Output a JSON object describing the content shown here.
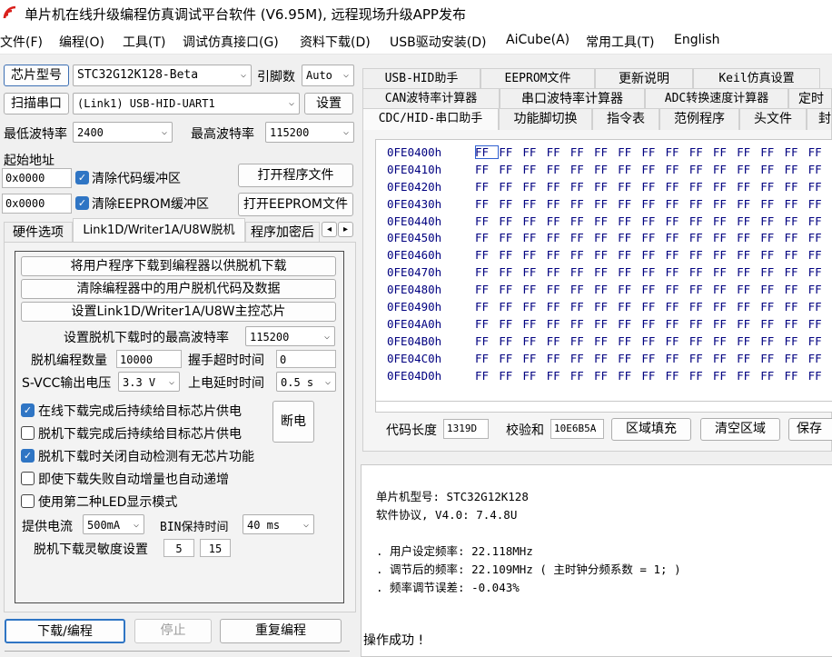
{
  "window": {
    "title": "单片机在线升级编程仿真调试平台软件 (V6.95M), 远程现场升级APP发布"
  },
  "menu": [
    "文件(F)",
    "编程(O)",
    "工具(T)",
    "调试仿真接口(G)",
    "资料下载(D)",
    "USB驱动安装(D)",
    "AiCube(A)",
    "常用工具(T)",
    "English"
  ],
  "left": {
    "chip_type_label": "芯片型号",
    "chip_type_value": "STC32G12K128-Beta",
    "pin_label": "引脚数",
    "pin_value": "Auto",
    "scan_port_label": "扫描串口",
    "port_value": "(Link1) USB-HID-UART1",
    "settings_label": "设置",
    "min_baud_label": "最低波特率",
    "min_baud_value": "2400",
    "max_baud_label": "最高波特率",
    "max_baud_value": "115200",
    "start_addr_label": "起始地址",
    "code_addr": "0x0000",
    "clear_code_label": "清除代码缓冲区",
    "open_program_label": "打开程序文件",
    "eeprom_addr": "0x0000",
    "clear_eeprom_label": "清除EEPROM缓冲区",
    "open_eeprom_label": "打开EEPROM文件",
    "tabs": [
      "硬件选项",
      "Link1D/Writer1A/U8W脱机",
      "程序加密后"
    ],
    "tab_scroll_left": "◂",
    "tab_scroll_right": "▸",
    "panel": {
      "btn_download_to_programmer": "将用户程序下载到编程器以供脱机下载",
      "btn_clear_programmer": "清除编程器中的用户脱机代码及数据",
      "btn_set_master": "设置Link1D/Writer1A/U8W主控芯片",
      "max_baud_offline_label": "设置脱机下载时的最高波特率",
      "max_baud_offline_value": "115200",
      "offline_count_label": "脱机编程数量",
      "offline_count_value": "10000",
      "handshake_label": "握手超时时间",
      "handshake_value": "0",
      "svcc_label": "S-VCC输出电压",
      "svcc_value": "3.3 V",
      "power_delay_label": "上电延时时间",
      "power_delay_value": "0.5 s",
      "options": [
        {
          "label": "在线下载完成后持续给目标芯片供电",
          "checked": true
        },
        {
          "label": "脱机下载完成后持续给目标芯片供电",
          "checked": false
        },
        {
          "label": "脱机下载时关闭自动检测有无芯片功能",
          "checked": true
        },
        {
          "label": "即使下载失败自动增量也自动递增",
          "checked": false
        },
        {
          "label": "使用第二种LED显示模式",
          "checked": false
        }
      ],
      "power_off_label": "断电",
      "supply_current_label": "提供电流",
      "supply_current_value": "500mA",
      "bin_hold_label": "BIN保持时间",
      "bin_hold_value": "40 ms",
      "sensitivity_label": "脱机下载灵敏度设置",
      "sensitivity_a": "5",
      "sensitivity_b": "15"
    },
    "download_label": "下载/编程",
    "stop_label": "停止",
    "reprogram_label": "重复编程"
  },
  "right": {
    "tabs_row1": [
      "USB-HID助手",
      "EEPROM文件",
      "更新说明",
      "Keil仿真设置"
    ],
    "tabs_row2": [
      "CAN波特率计算器",
      "串口波特率计算器",
      "ADC转换速度计算器",
      "定时"
    ],
    "tabs_row3": [
      "CDC/HID-串口助手",
      "功能脚切换",
      "指令表",
      "范例程序",
      "头文件",
      "封"
    ],
    "hex_rows": [
      {
        "addr": "0FE0400h",
        "bytes": [
          "FF",
          "FF",
          "FF",
          "FF",
          "FF",
          "FF",
          "FF",
          "FF",
          "FF",
          "FF",
          "FF",
          "FF",
          "FF",
          "FF",
          "FF"
        ]
      },
      {
        "addr": "0FE0410h",
        "bytes": [
          "FF",
          "FF",
          "FF",
          "FF",
          "FF",
          "FF",
          "FF",
          "FF",
          "FF",
          "FF",
          "FF",
          "FF",
          "FF",
          "FF",
          "FF"
        ]
      },
      {
        "addr": "0FE0420h",
        "bytes": [
          "FF",
          "FF",
          "FF",
          "FF",
          "FF",
          "FF",
          "FF",
          "FF",
          "FF",
          "FF",
          "FF",
          "FF",
          "FF",
          "FF",
          "FF"
        ]
      },
      {
        "addr": "0FE0430h",
        "bytes": [
          "FF",
          "FF",
          "FF",
          "FF",
          "FF",
          "FF",
          "FF",
          "FF",
          "FF",
          "FF",
          "FF",
          "FF",
          "FF",
          "FF",
          "FF"
        ]
      },
      {
        "addr": "0FE0440h",
        "bytes": [
          "FF",
          "FF",
          "FF",
          "FF",
          "FF",
          "FF",
          "FF",
          "FF",
          "FF",
          "FF",
          "FF",
          "FF",
          "FF",
          "FF",
          "FF"
        ]
      },
      {
        "addr": "0FE0450h",
        "bytes": [
          "FF",
          "FF",
          "FF",
          "FF",
          "FF",
          "FF",
          "FF",
          "FF",
          "FF",
          "FF",
          "FF",
          "FF",
          "FF",
          "FF",
          "FF"
        ]
      },
      {
        "addr": "0FE0460h",
        "bytes": [
          "FF",
          "FF",
          "FF",
          "FF",
          "FF",
          "FF",
          "FF",
          "FF",
          "FF",
          "FF",
          "FF",
          "FF",
          "FF",
          "FF",
          "FF"
        ]
      },
      {
        "addr": "0FE0470h",
        "bytes": [
          "FF",
          "FF",
          "FF",
          "FF",
          "FF",
          "FF",
          "FF",
          "FF",
          "FF",
          "FF",
          "FF",
          "FF",
          "FF",
          "FF",
          "FF"
        ]
      },
      {
        "addr": "0FE0480h",
        "bytes": [
          "FF",
          "FF",
          "FF",
          "FF",
          "FF",
          "FF",
          "FF",
          "FF",
          "FF",
          "FF",
          "FF",
          "FF",
          "FF",
          "FF",
          "FF"
        ]
      },
      {
        "addr": "0FE0490h",
        "bytes": [
          "FF",
          "FF",
          "FF",
          "FF",
          "FF",
          "FF",
          "FF",
          "FF",
          "FF",
          "FF",
          "FF",
          "FF",
          "FF",
          "FF",
          "FF"
        ]
      },
      {
        "addr": "0FE04A0h",
        "bytes": [
          "FF",
          "FF",
          "FF",
          "FF",
          "FF",
          "FF",
          "FF",
          "FF",
          "FF",
          "FF",
          "FF",
          "FF",
          "FF",
          "FF",
          "FF"
        ]
      },
      {
        "addr": "0FE04B0h",
        "bytes": [
          "FF",
          "FF",
          "FF",
          "FF",
          "FF",
          "FF",
          "FF",
          "FF",
          "FF",
          "FF",
          "FF",
          "FF",
          "FF",
          "FF",
          "FF"
        ]
      },
      {
        "addr": "0FE04C0h",
        "bytes": [
          "FF",
          "FF",
          "FF",
          "FF",
          "FF",
          "FF",
          "FF",
          "FF",
          "FF",
          "FF",
          "FF",
          "FF",
          "FF",
          "FF",
          "FF"
        ]
      },
      {
        "addr": "0FE04D0h",
        "bytes": [
          "FF",
          "FF",
          "FF",
          "FF",
          "FF",
          "FF",
          "FF",
          "FF",
          "FF",
          "FF",
          "FF",
          "FF",
          "FF",
          "FF",
          "FF"
        ]
      }
    ],
    "code_length_label": "代码长度",
    "code_length_value": "1319D",
    "checksum_label": "校验和",
    "checksum_value": "10E6B5A",
    "fill_label": "区域填充",
    "clear_label": "清空区域",
    "save_label": "保存"
  },
  "log": {
    "lines": [
      "单片机型号: STC32G12K128",
      "软件协议, V4.0: 7.4.8U",
      "",
      ". 用户设定频率: 22.118MHz",
      ". 调节后的频率: 22.109MHz ( 主时钟分频系数 = 1; )",
      ". 频率调节误差: -0.043%"
    ],
    "status": "操作成功 !"
  },
  "colors": {
    "accent": "#2f75c4",
    "logo": "#d9201c"
  }
}
